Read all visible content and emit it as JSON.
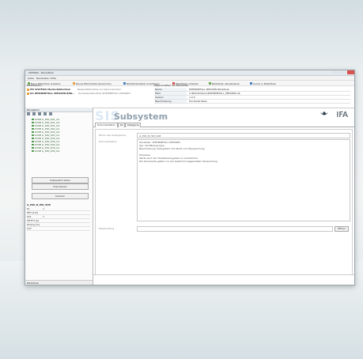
{
  "window": {
    "title": "SISTEMA - Bauartbeh"
  },
  "menu": [
    "Datei",
    "Bearbeiten",
    "Hilfe"
  ],
  "toolbar": {
    "items": [
      "Neue Bibliothek erstellen",
      "Neues Bibliotheks-Verzeichnis",
      "Bibliotheksdatei hinzufügen",
      "Bibliothek entladen",
      "Bibliothek aktualisieren",
      "Suche in Bibliothek"
    ]
  },
  "libraries": {
    "title": "Bibliotheken",
    "items": [
      {
        "name": "IFA SISTEMA Musterbibliothek",
        "desc": "Beispielbibliothek zur Demonstration"
      },
      {
        "name": "KA RHEINMETALL MEISSEN BIBL..",
        "desc": "Herstellerbibliothek RHEINMETALL MEISSEN"
      }
    ]
  },
  "properties": {
    "title": "Eigenschaften der Bibliothek",
    "rows": [
      {
        "key": "Name",
        "value": "RHEINMETALL MEISSEN Bibliothek"
      },
      {
        "key": "Pfad",
        "value": "C:\\Bibliotheken\\RHEINMETALL_MEISSEN.slb"
      },
      {
        "key": "Version",
        "value": "1.0.0"
      },
      {
        "key": "Beschreibung",
        "value": "Herstellerdaten"
      }
    ]
  },
  "left": {
    "title": "Navigation",
    "tree": [
      "KVSB G_P00_K01_G1",
      "KVSB G_P00_K01_G2",
      "KVSB G_P00_K01_G3",
      "KVSB G_P00_K02_G1",
      "KVSB G_P00_K02_G2",
      "KVSB G_P00_K03_G1",
      "KVSB G_P00_K03_G2",
      "KVSB G_P00_K04_G1",
      "KVSB G_P00_K04_G2",
      "KVSB G_P00_K05_G1",
      "KVSB G_P00_K05_G2"
    ],
    "buttons": [
      "Subsystem laden",
      "Importieren",
      "Löschen"
    ],
    "params": {
      "heading": "G_P00_B_HW_SUB",
      "rows": [
        {
          "key": "PL",
          "value": "d"
        },
        {
          "key": "PFH [1/h]",
          "value": ""
        },
        {
          "key": "Kat.",
          "value": "3"
        },
        {
          "key": "MTTFd [a]",
          "value": ""
        },
        {
          "key": "DCavg [%]",
          "value": ""
        },
        {
          "key": "CCF",
          "value": ""
        }
      ]
    },
    "footer": "Bibliothek"
  },
  "main": {
    "brand": {
      "sis": "SIS",
      "subtitle": "Subsystem",
      "ifa": "IFA"
    },
    "tabs": [
      "Dokumentation",
      "PL",
      "Kategorie"
    ],
    "fields": {
      "name_label": "Name des Subsystems",
      "name_value": "G_P00_B_HW_SUB",
      "doc_label": "Dokumentation",
      "doc_lines": [
        "Hersteller: RHEINMETALL MEISSEN",
        "Typ: Ventilbaugruppe",
        "Beschreibung: Subsystem mit Ventil und Überwachung",
        "",
        "Hinweise:",
        "Werte sind den Herstellerangaben zu entnehmen.",
        "Die Kennwerte gelten nur bei bestimmungsgemäßer Verwendung.",
        ""
      ],
      "file_label": "Dateianhang",
      "browse_button": "Öffnen"
    }
  },
  "colors": {
    "accent": "#4a7fc1",
    "brand": "#2f3c4a"
  }
}
